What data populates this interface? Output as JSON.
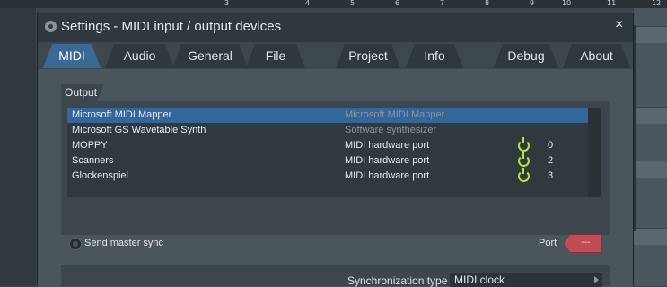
{
  "ruler": [
    "3",
    "4",
    "5",
    "6",
    "7",
    "8",
    "9",
    "10",
    "11",
    "12"
  ],
  "dialog": {
    "title": "Settings - MIDI input / output devices",
    "close": "×"
  },
  "tabs": [
    {
      "label": "MIDI",
      "active": true
    },
    {
      "label": "Audio"
    },
    {
      "label": "General"
    },
    {
      "label": "File"
    },
    {
      "label": "Project"
    },
    {
      "label": "Info"
    },
    {
      "label": "Debug"
    },
    {
      "label": "About"
    }
  ],
  "output": {
    "section_label": "Output",
    "rows": [
      {
        "name": "Microsoft MIDI Mapper",
        "type": "Microsoft MIDI Mapper",
        "port": "",
        "power": false,
        "selected": true
      },
      {
        "name": "Microsoft GS Wavetable Synth",
        "type": "Software synthesizer",
        "port": "",
        "power": false
      },
      {
        "name": "MOPPY",
        "type": "MIDI hardware port",
        "port": "0",
        "power": true
      },
      {
        "name": "Scanners",
        "type": "MIDI hardware port",
        "port": "2",
        "power": true
      },
      {
        "name": "Glockenspiel",
        "type": "MIDI hardware port",
        "port": "3",
        "power": true
      }
    ],
    "send_master_sync": "Send master sync",
    "port_label": "Port",
    "port_value": "---"
  },
  "sync": {
    "label": "Synchronization type",
    "value": "MIDI clock"
  },
  "colors": {
    "accent": "#3a6a93",
    "selection": "#33669a",
    "power": "#b6e43a",
    "port_button": "#c04c55"
  }
}
